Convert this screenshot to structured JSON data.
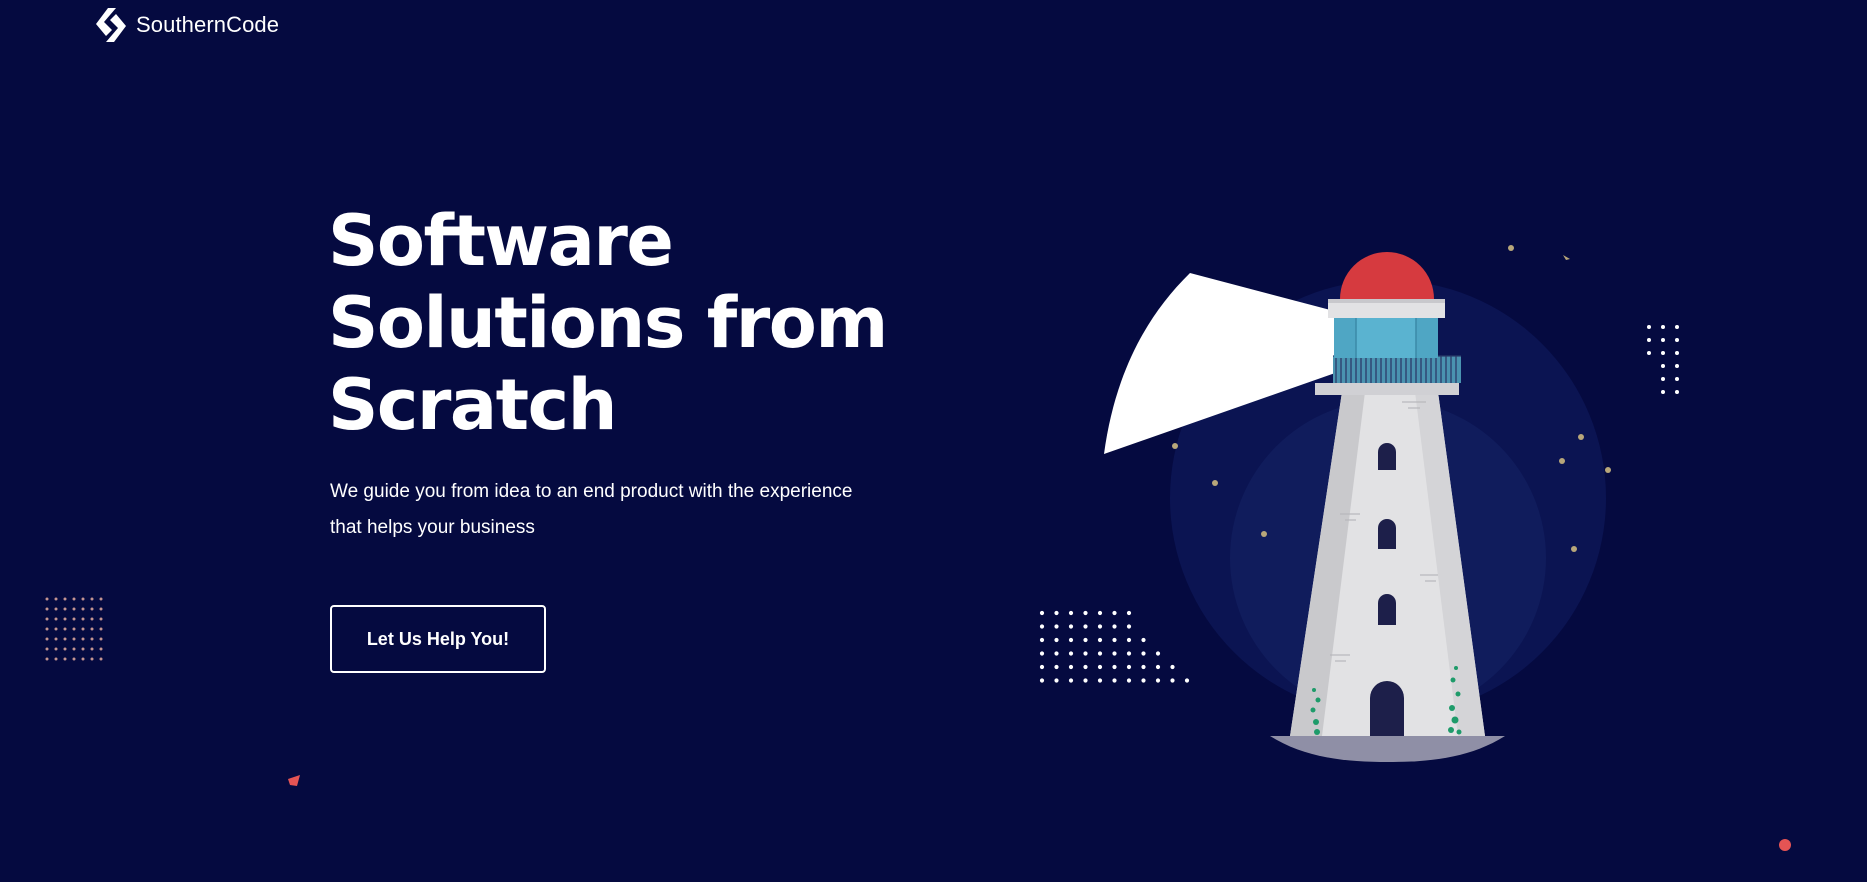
{
  "header": {
    "brand_name": "SouthernCode",
    "logo_icon": "southerncode-logo-icon"
  },
  "hero": {
    "headline_line1": "Software",
    "headline_line2": "Solutions from",
    "headline_line3": "Scratch",
    "subtext_line1": "We guide you from idea to an end product with the experience",
    "subtext_line2": "that helps your business",
    "cta_label": "Let Us Help You!"
  },
  "illustration": {
    "subject": "lighthouse-illustration",
    "colors": {
      "background": "#050a40",
      "lamp_dome": "#d63a3f",
      "lantern_glass": "#4fa6c4",
      "tower": "#e2e2e4",
      "door": "#1d1f4a",
      "vines": "#1e9b6a",
      "accent_dot": "#e55454"
    }
  }
}
